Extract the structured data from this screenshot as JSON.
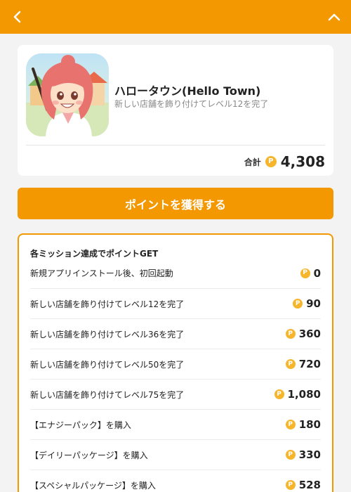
{
  "app": {
    "name": "ハロータウン(Hello Town)",
    "description": "新しい店舗を飾り付けてレベル12を完了",
    "total_label": "合計",
    "total_value": "4,308",
    "coin_symbol": "P"
  },
  "cta": {
    "label": "ポイントを獲得する"
  },
  "missions": {
    "title": "各ミッション達成でポイントGET",
    "items": [
      {
        "text": "新規アプリインストール後、初回起動",
        "points": "0"
      },
      {
        "text": "新しい店舗を飾り付けてレベル12を完了",
        "points": "90"
      },
      {
        "text": "新しい店舗を飾り付けてレベル36を完了",
        "points": "360"
      },
      {
        "text": "新しい店舗を飾り付けてレベル50を完了",
        "points": "720"
      },
      {
        "text": "新しい店舗を飾り付けてレベル75を完了",
        "points": "1,080"
      },
      {
        "text": "【エナジーパック】を購入",
        "points": "180"
      },
      {
        "text": "【デイリーパッケージ】を購入",
        "points": "330"
      },
      {
        "text": "【スペシャルパッケージ】を購入",
        "points": "528"
      }
    ]
  },
  "colors": {
    "accent": "#f39800",
    "coin": "#f7b52c",
    "background": "#f3f3f3"
  }
}
